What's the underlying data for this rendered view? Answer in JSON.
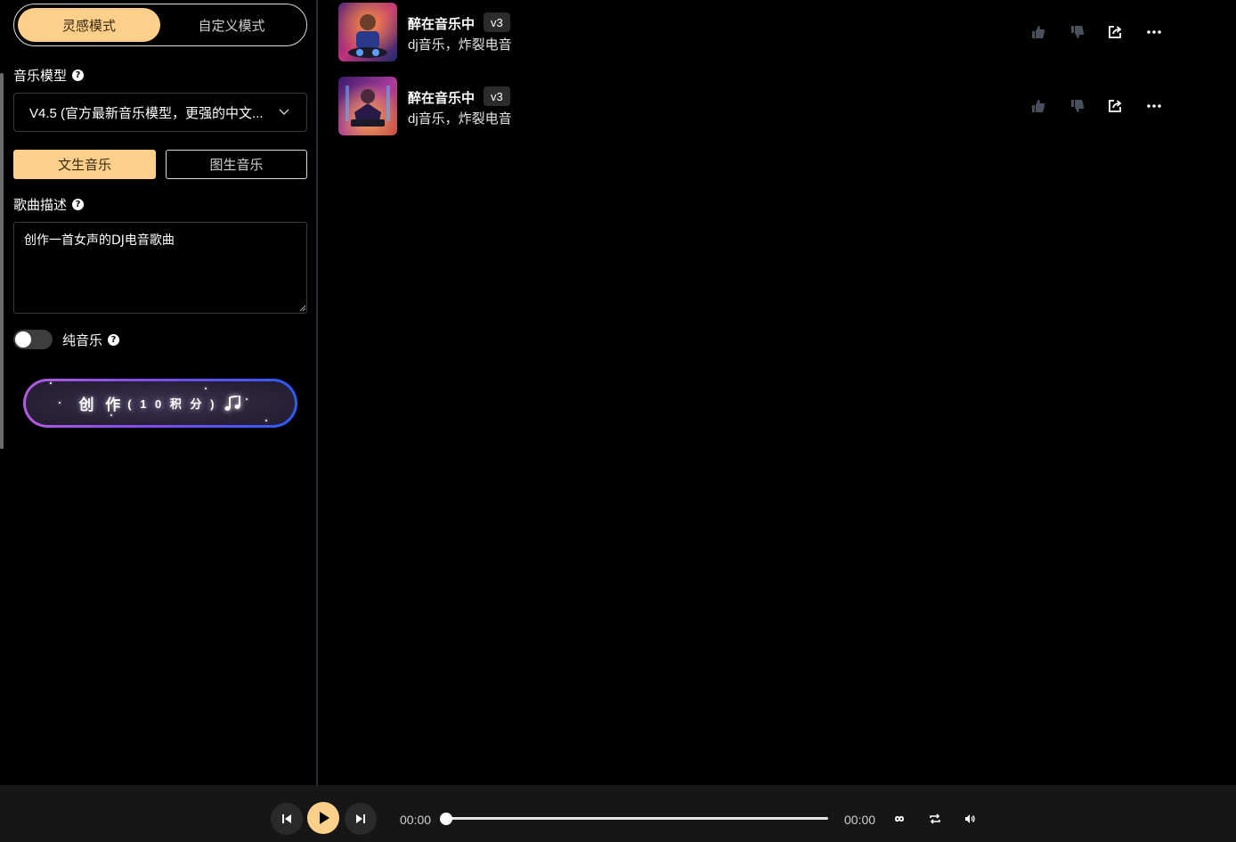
{
  "mode_toggle": {
    "inspiration": "灵感模式",
    "custom": "自定义模式"
  },
  "model": {
    "label": "音乐模型",
    "selected": "V4.5 (官方最新音乐模型，更强的中文..."
  },
  "source_tabs": {
    "text": "文生音乐",
    "image": "图生音乐"
  },
  "description": {
    "label": "歌曲描述",
    "value": "创作一首女声的DJ电音歌曲"
  },
  "instrumental": {
    "label": "纯音乐",
    "enabled": false
  },
  "create_button": {
    "main": "创 作",
    "cost": "( 1 0 积 分 )"
  },
  "songs": [
    {
      "title": "醉在音乐中",
      "version": "v3",
      "tags": "dj音乐，炸裂电音"
    },
    {
      "title": "醉在音乐中",
      "version": "v3",
      "tags": "dj音乐，炸裂电音"
    }
  ],
  "player": {
    "current_time": "00:00",
    "duration": "00:00",
    "progress": 0
  },
  "colors": {
    "accent": "#fcd08a",
    "panel_border": "#2b2b33",
    "player_bg": "#161616"
  },
  "icons": [
    "question-icon",
    "chevron-down-icon",
    "music-note-icon",
    "thumbs-up-icon",
    "thumbs-down-icon",
    "share-icon",
    "more-icon",
    "previous-icon",
    "play-icon",
    "next-icon",
    "infinity-icon",
    "repeat-icon",
    "volume-icon"
  ]
}
